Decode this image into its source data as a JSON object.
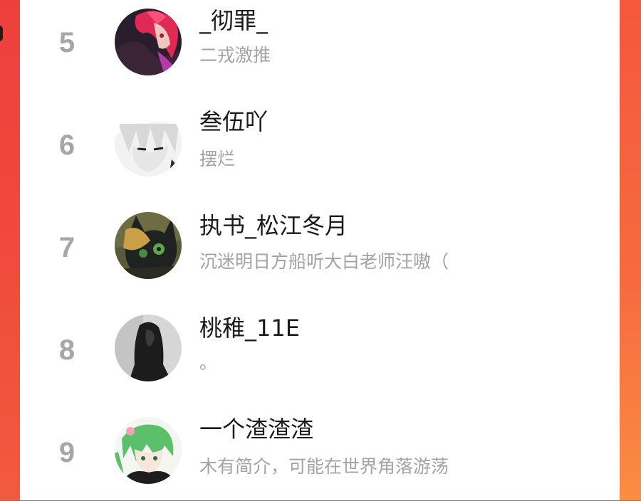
{
  "leaderboard": {
    "entries": [
      {
        "rank": "5",
        "username": "_彻罪_",
        "bio": "二戎激推",
        "avatar": "avatar-red-hair-anime"
      },
      {
        "rank": "6",
        "username": "叁伍吖",
        "bio": "摆烂",
        "avatar": "avatar-white-hair-manga"
      },
      {
        "rank": "7",
        "username": "执书_松江冬月",
        "bio": "沉迷明日方船听大白老师汪嗷（",
        "avatar": "avatar-cat-mask-hero"
      },
      {
        "rank": "8",
        "username": "桃稚_11E",
        "bio": "。",
        "avatar": "avatar-dark-hair-photo"
      },
      {
        "rank": "9",
        "username": "一个渣渣渣",
        "bio": "木有简介，可能在世界角落游荡",
        "avatar": "avatar-green-hair-anime"
      }
    ]
  },
  "colors": {
    "background_accent": "#f24a3c",
    "panel": "#ffffff",
    "rank_number": "#a6a6a6",
    "username": "#1a1a1a",
    "bio": "#a3a3a3"
  }
}
